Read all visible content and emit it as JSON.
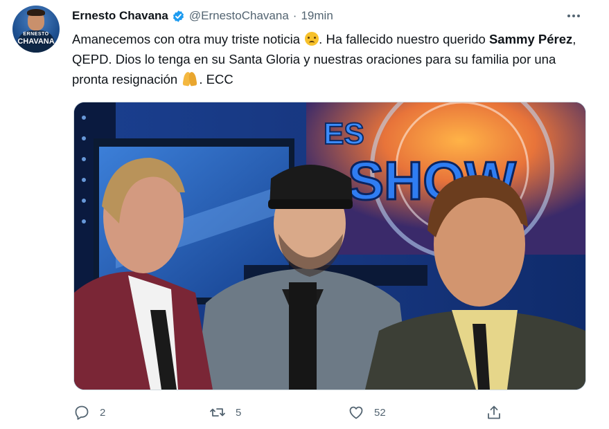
{
  "author": {
    "name": "Ernesto Chavana",
    "handle": "@ErnestoChavana",
    "time": "19min",
    "verified": true,
    "avatar_text_top": "ERNESTO",
    "avatar_text_bottom": "CHAVANA"
  },
  "tweet": {
    "text_part1": "Amanecemos con otra muy triste noticia ",
    "emoji1": "sad-tear-emoji",
    "text_part2": ". Ha fallecido nuestro querido ",
    "bold_name": "Sammy Pérez",
    "text_part3": ", QEPD. Dios lo tenga en su Santa Gloria y nuestras oraciones para su familia por una pronta resignación ",
    "emoji2": "folded-hands-emoji",
    "text_part4": ". ECC"
  },
  "media": {
    "sign_top": "ES",
    "sign_bottom": "SHOW"
  },
  "actions": {
    "replies": "2",
    "retweets": "5",
    "likes": "52"
  },
  "colors": {
    "verified": "#1d9bf0",
    "secondary_text": "#536471",
    "primary_text": "#0f1419"
  }
}
